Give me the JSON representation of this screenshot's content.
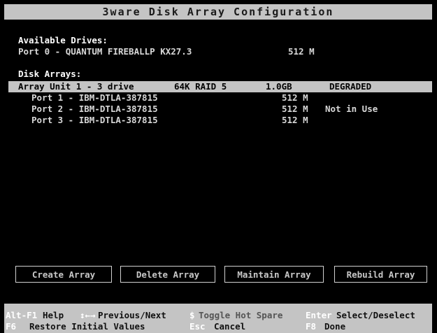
{
  "window": {
    "title": "3ware Disk Array Configuration"
  },
  "available": {
    "heading": "Available Drives:",
    "drives": [
      {
        "port": "Port 0 - QUANTUM FIREBALLP KX27.3",
        "size": "512 M"
      }
    ]
  },
  "arrays": {
    "heading": "Disk Arrays:",
    "unit": {
      "name": "Array Unit 1 - 3 drive",
      "config": "64K RAID 5",
      "capacity": "1.0GB",
      "status": "DEGRADED"
    },
    "members": [
      {
        "port": "Port 1 - IBM-DTLA-387815",
        "size": "512 M",
        "note": ""
      },
      {
        "port": "Port 2 - IBM-DTLA-387815",
        "size": "512 M",
        "note": "Not in Use"
      },
      {
        "port": "Port 3 - IBM-DTLA-387815",
        "size": "512 M",
        "note": ""
      }
    ]
  },
  "buttons": {
    "create": "Create Array",
    "delete": "Delete Array",
    "maintain": "Maintain Array",
    "rebuild": "Rebuild Array"
  },
  "footer": {
    "row1": [
      {
        "key": "Alt-F1",
        "desc": "Help"
      },
      {
        "key": "↕←→",
        "desc": "Previous/Next"
      },
      {
        "key": "$",
        "desc": "Toggle Hot Spare"
      },
      {
        "key": "Enter",
        "desc": "Select/Deselect"
      }
    ],
    "row2": [
      {
        "key": "F6",
        "desc": "Restore Initial Values"
      },
      {
        "key": "Esc",
        "desc": "Cancel"
      },
      {
        "key": "F8",
        "desc": "Done"
      }
    ]
  },
  "colors": {
    "background": "#000000",
    "bar": "#c4c4c4",
    "text": "#d8d8d8",
    "key": "#ffffff"
  }
}
